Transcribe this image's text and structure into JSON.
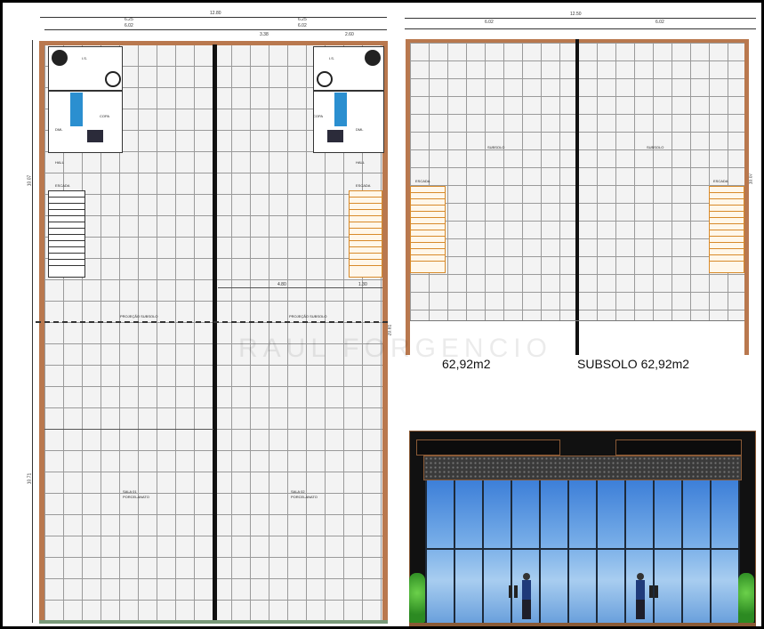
{
  "ground_floor": {
    "dims_top": [
      "12.80",
      "6.25",
      "6.02",
      "6.25",
      "6.02",
      "3.38",
      "2.60"
    ],
    "dim_left_top": "10.07",
    "dim_left_bottom": "10.71",
    "dim_right": "20.81",
    "dim_mid": [
      "4.80",
      "1.30"
    ],
    "rooms": {
      "ls_left": "I.S.",
      "ls_right": "I.S.",
      "copa_left": "COPA",
      "copa_right": "COPA",
      "dml_left": "DML",
      "dml_right": "DML",
      "hall_left": "HALL",
      "hall_right": "HALL",
      "escada_left": "ESCADA",
      "escada_right": "ESCADA",
      "sala_left": "SALA 01",
      "sala_right": "SALA 02",
      "proj_left": "PROJEÇÃO SUBSOLO",
      "proj_right": "PROJEÇÃO SUBSOLO"
    },
    "floor_note": "PORCELANATO"
  },
  "subsolo_plan": {
    "dims_top": [
      "12.50",
      "6.02",
      "6.02"
    ],
    "dim_right": "10.07",
    "room_left": "SUBSOLO",
    "room_right": "SUBSOLO",
    "escada_left": "ESCADA",
    "escada_right": "ESCADA",
    "area_left": "62,92m2",
    "area_right": "SUBSOLO  62,92m2"
  },
  "watermark": "RAUL FORGENCIO"
}
